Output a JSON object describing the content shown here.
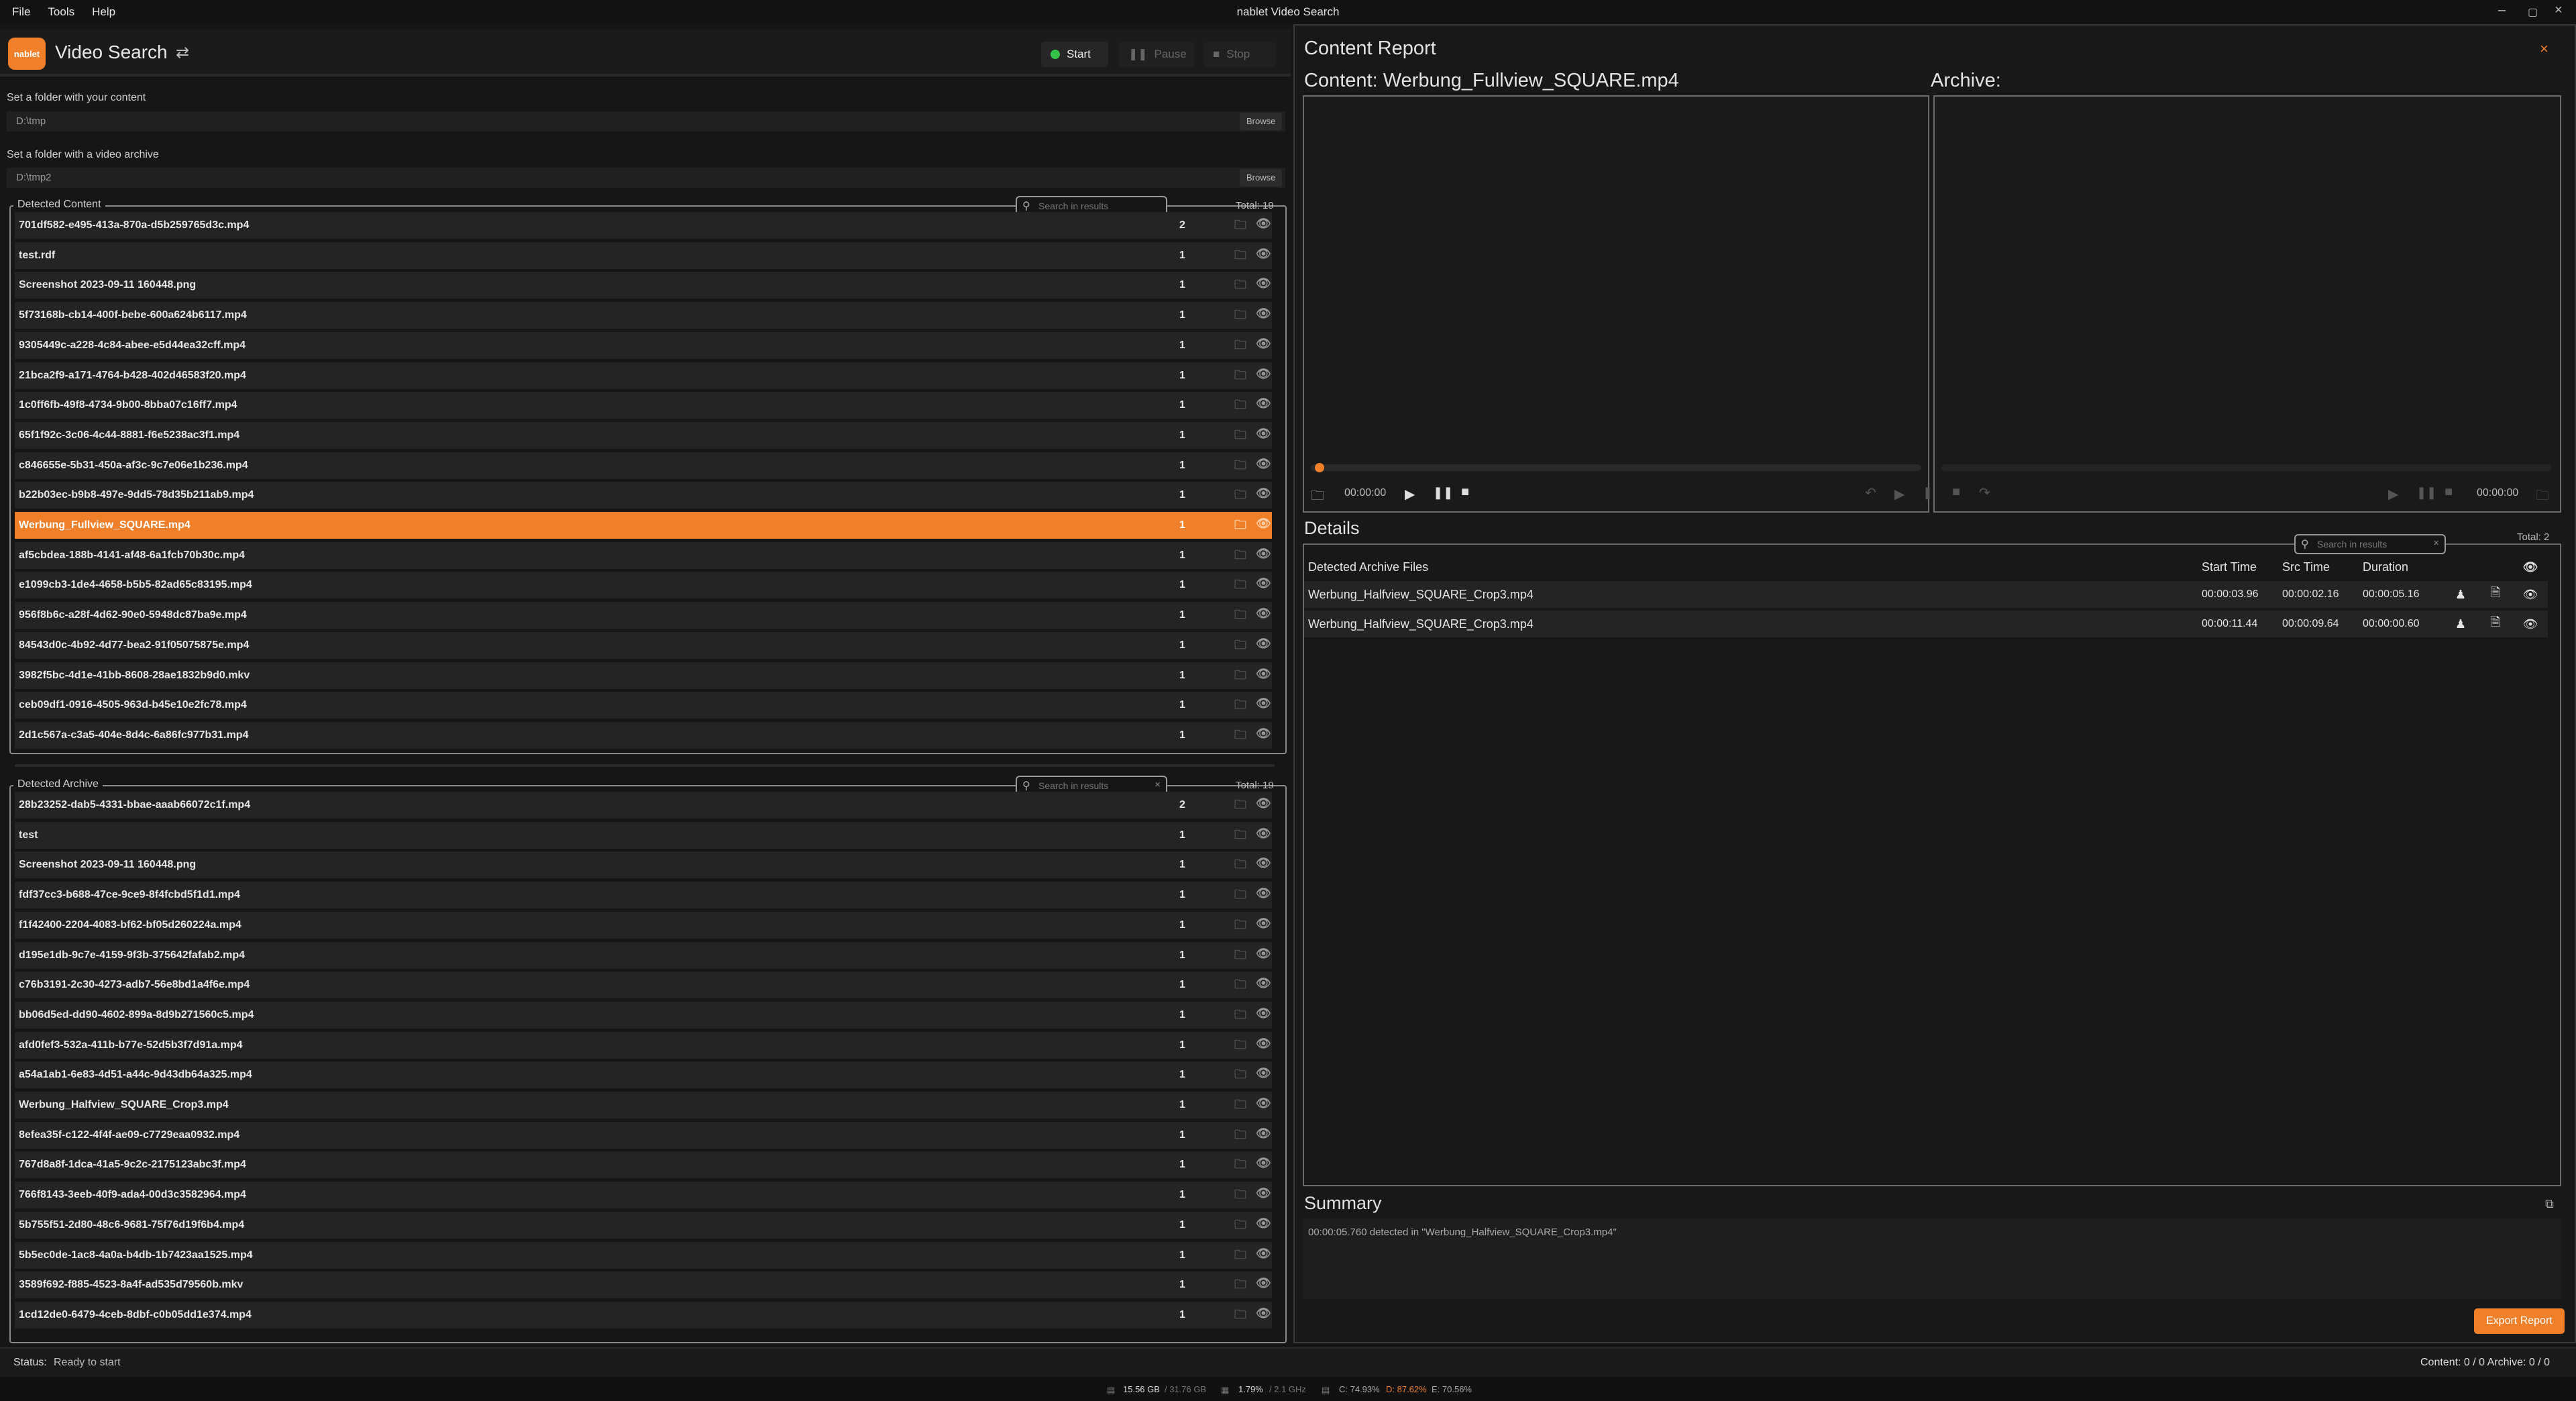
{
  "window": {
    "title": "nablet Video Search",
    "menu": [
      "File",
      "Tools",
      "Help"
    ]
  },
  "toolbar": {
    "app_title": "Video Search",
    "logo": "nablet",
    "start": "Start",
    "pause": "Pause",
    "stop": "Stop",
    "accent": "#f07f2a"
  },
  "content_folder": {
    "label": "Set a folder with your content",
    "path": "D:\\tmp",
    "browse": "Browse"
  },
  "archive_folder": {
    "label": "Set a folder with a video archive",
    "path": "D:\\tmp2",
    "browse": "Browse"
  },
  "detected_content": {
    "title": "Detected Content",
    "search_placeholder": "Search in results",
    "total": "Total: 19",
    "rows": [
      {
        "name": "701df582-e495-413a-870a-d5b259765d3c.mp4",
        "count": "2"
      },
      {
        "name": "test.rdf",
        "count": "1"
      },
      {
        "name": "Screenshot 2023-09-11 160448.png",
        "count": "1"
      },
      {
        "name": "5f73168b-cb14-400f-bebe-600a624b6117.mp4",
        "count": "1"
      },
      {
        "name": "9305449c-a228-4c84-abee-e5d44ea32cff.mp4",
        "count": "1"
      },
      {
        "name": "21bca2f9-a171-4764-b428-402d46583f20.mp4",
        "count": "1"
      },
      {
        "name": "1c0ff6fb-49f8-4734-9b00-8bba07c16ff7.mp4",
        "count": "1"
      },
      {
        "name": "65f1f92c-3c06-4c44-8881-f6e5238ac3f1.mp4",
        "count": "1"
      },
      {
        "name": "c846655e-5b31-450a-af3c-9c7e06e1b236.mp4",
        "count": "1"
      },
      {
        "name": "b22b03ec-b9b8-497e-9dd5-78d35b211ab9.mp4",
        "count": "1"
      },
      {
        "name": "Werbung_Fullview_SQUARE.mp4",
        "count": "1",
        "selected": true
      },
      {
        "name": "af5cbdea-188b-4141-af48-6a1fcb70b30c.mp4",
        "count": "1"
      },
      {
        "name": "e1099cb3-1de4-4658-b5b5-82ad65c83195.mp4",
        "count": "1"
      },
      {
        "name": "956f8b6c-a28f-4d62-90e0-5948dc87ba9e.mp4",
        "count": "1"
      },
      {
        "name": "84543d0c-4b92-4d77-bea2-91f05075875e.mp4",
        "count": "1"
      },
      {
        "name": "3982f5bc-4d1e-41bb-8608-28ae1832b9d0.mkv",
        "count": "1"
      },
      {
        "name": "ceb09df1-0916-4505-963d-b45e10e2fc78.mp4",
        "count": "1"
      },
      {
        "name": "2d1c567a-c3a5-404e-8d4c-6a86fc977b31.mp4",
        "count": "1"
      }
    ]
  },
  "detected_archive": {
    "title": "Detected Archive",
    "search_placeholder": "Search in results",
    "total": "Total: 19",
    "rows": [
      {
        "name": "28b23252-dab5-4331-bbae-aaab66072c1f.mp4",
        "count": "2"
      },
      {
        "name": "test",
        "count": "1"
      },
      {
        "name": "Screenshot 2023-09-11 160448.png",
        "count": "1"
      },
      {
        "name": "fdf37cc3-b688-47ce-9ce9-8f4fcbd5f1d1.mp4",
        "count": "1"
      },
      {
        "name": "f1f42400-2204-4083-bf62-bf05d260224a.mp4",
        "count": "1"
      },
      {
        "name": "d195e1db-9c7e-4159-9f3b-375642fafab2.mp4",
        "count": "1"
      },
      {
        "name": "c76b3191-2c30-4273-adb7-56e8bd1a4f6e.mp4",
        "count": "1"
      },
      {
        "name": "bb06d5ed-dd90-4602-899a-8d9b271560c5.mp4",
        "count": "1"
      },
      {
        "name": "afd0fef3-532a-411b-b77e-52d5b3f7d91a.mp4",
        "count": "1"
      },
      {
        "name": "a54a1ab1-6e83-4d51-a44c-9d43db64a325.mp4",
        "count": "1"
      },
      {
        "name": "Werbung_Halfview_SQUARE_Crop3.mp4",
        "count": "1"
      },
      {
        "name": "8efea35f-c122-4f4f-ae09-c7729eaa0932.mp4",
        "count": "1"
      },
      {
        "name": "767d8a8f-1dca-41a5-9c2c-2175123abc3f.mp4",
        "count": "1"
      },
      {
        "name": "766f8143-3eeb-40f9-ada4-00d3c3582964.mp4",
        "count": "1"
      },
      {
        "name": "5b755f51-2d80-48c6-9681-75f76d19f6b4.mp4",
        "count": "1"
      },
      {
        "name": "5b5ec0de-1ac8-4a0a-b4db-1b7423aa1525.mp4",
        "count": "1"
      },
      {
        "name": "3589f692-f885-4523-8a4f-ad535d79560b.mkv",
        "count": "1"
      },
      {
        "name": "1cd12de0-6479-4ceb-8dbf-c0b05dd1e374.mp4",
        "count": "1"
      }
    ]
  },
  "report": {
    "title": "Content Report",
    "content_label": "Content:",
    "content_file": "Werbung_Fullview_SQUARE.mp4",
    "archive_label": "Archive:",
    "content_time": "00:00:00",
    "archive_time": "00:00:00",
    "details_title": "Details",
    "details_total": "Total: 2",
    "details_search_placeholder": "Search in results",
    "columns": [
      "Detected Archive Files",
      "Start Time",
      "Src Time",
      "Duration"
    ],
    "rows": [
      {
        "file": "Werbung_Halfview_SQUARE_Crop3.mp4",
        "start": "00:00:03.96",
        "src": "00:00:02.16",
        "duration": "00:00:05.16"
      },
      {
        "file": "Werbung_Halfview_SQUARE_Crop3.mp4",
        "start": "00:00:11.44",
        "src": "00:00:09.64",
        "duration": "00:00:00.60"
      }
    ],
    "summary_title": "Summary",
    "summary_text": "00:00:05.760 detected in \"Werbung_Halfview_SQUARE_Crop3.mp4\"",
    "export": "Export Report"
  },
  "status": {
    "label": "Status:",
    "text": "Ready to start",
    "right": "Content: 0 / 0  Archive: 0 / 0"
  },
  "info": {
    "mem": "15.56 GB",
    "mem_total": "/ 31.76 GB",
    "cpu": "1.79%",
    "cpu_freq": "/ 2.1 GHz",
    "disk_c": "C: 74.93%",
    "disk_d": "D: 87.62%",
    "disk_e": "E: 70.56%"
  }
}
